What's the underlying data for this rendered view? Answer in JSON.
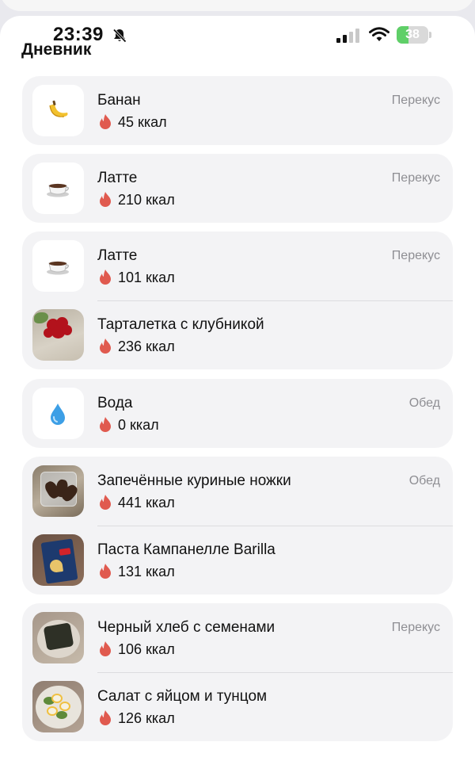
{
  "status_bar": {
    "time": "23:39",
    "battery_level": "38",
    "battery_fraction": 0.38,
    "icons": [
      "bell-slash-icon",
      "cellular-signal-icon",
      "wifi-icon",
      "battery-icon"
    ]
  },
  "header": {
    "title": "Дневник"
  },
  "colors": {
    "card_background": "#f3f3f5",
    "flame": "#e05a4f",
    "meal_tag": "#8e8e93",
    "battery": "#5fcf68"
  },
  "entries": [
    {
      "name": "Банан",
      "kcal": "45 ккал",
      "meal": "Перекус",
      "icon": "banana-icon"
    },
    {
      "name": "Латте",
      "kcal": "210 ккал",
      "meal": "Перекус",
      "icon": "coffee-cup-icon"
    },
    {
      "name": "Латте",
      "kcal": "101 ккал",
      "meal": "Перекус",
      "icon": "coffee-cup-icon"
    },
    {
      "name": "Тарталетка с клубникой",
      "kcal": "236 ккал",
      "meal": "",
      "icon": "strawberry-tart-photo"
    },
    {
      "name": "Вода",
      "kcal": "0 ккал",
      "meal": "Обед",
      "icon": "water-drop-icon"
    },
    {
      "name": "Запечённые куриные ножки",
      "kcal": "441 ккал",
      "meal": "Обед",
      "icon": "chicken-legs-photo"
    },
    {
      "name": "Паста Кампанелле Barilla",
      "kcal": "131 ккал",
      "meal": "",
      "icon": "pasta-box-photo"
    },
    {
      "name": "Черный хлеб с семенами",
      "kcal": "106 ккал",
      "meal": "Перекус",
      "icon": "black-bread-photo"
    },
    {
      "name": "Салат с яйцом и тунцом",
      "kcal": "126 ккал",
      "meal": "",
      "icon": "egg-tuna-salad-photo"
    }
  ]
}
